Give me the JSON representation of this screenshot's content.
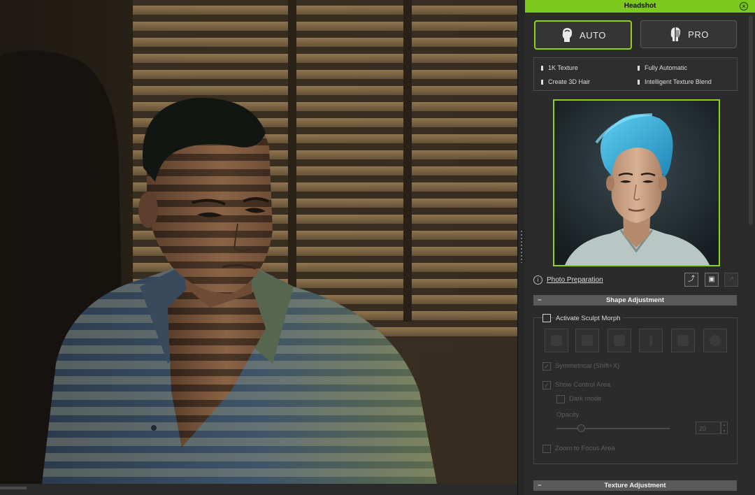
{
  "panel": {
    "title": "Headshot",
    "close_glyph": "×",
    "modes": {
      "auto_label": "AUTO",
      "pro_label": "PRO",
      "selected": "AUTO"
    },
    "features": {
      "f1": "1K Texture",
      "f2": "Fully Automatic",
      "f3": "Create 3D Hair",
      "f4": "Intelligent Texture Blend"
    },
    "photo_link": "Photo Preparation",
    "info_glyph": "i",
    "tools": {
      "import_glyph": "⤴",
      "save_glyph": "▣",
      "extra_glyph": "↗"
    },
    "shape_section": {
      "title": "Shape Adjustment",
      "collapse_glyph": "−",
      "activate_label": "Activate Sculpt Morph",
      "activate_checked": false,
      "symmetrical_label": "Symmetrical (Shift+X)",
      "symmetrical_checked": true,
      "show_control_label": "Show Control Area",
      "show_control_checked": true,
      "dark_mode_label": "Dark mode",
      "dark_mode_checked": false,
      "opacity_label": "Opacity",
      "opacity_value": "20",
      "zoom_label": "Zoom to Focus Area",
      "zoom_checked": false
    },
    "texture_section": {
      "title": "Texture Adjustment",
      "collapse_glyph": "−"
    }
  },
  "icons": {
    "auto": "head-silhouette-icon",
    "pro": "head-profile-icon",
    "info": "info-icon",
    "close": "close-icon",
    "sculpt_tools": [
      "brush-tool-icon",
      "smooth-tool-icon",
      "move-tool-icon",
      "pinch-tool-icon",
      "inflate-tool-icon",
      "undo-tool-icon"
    ]
  },
  "colors": {
    "accent": "#8ad21c",
    "titlebar": "#7dc81c",
    "panel_bg": "#2b2b2b"
  }
}
